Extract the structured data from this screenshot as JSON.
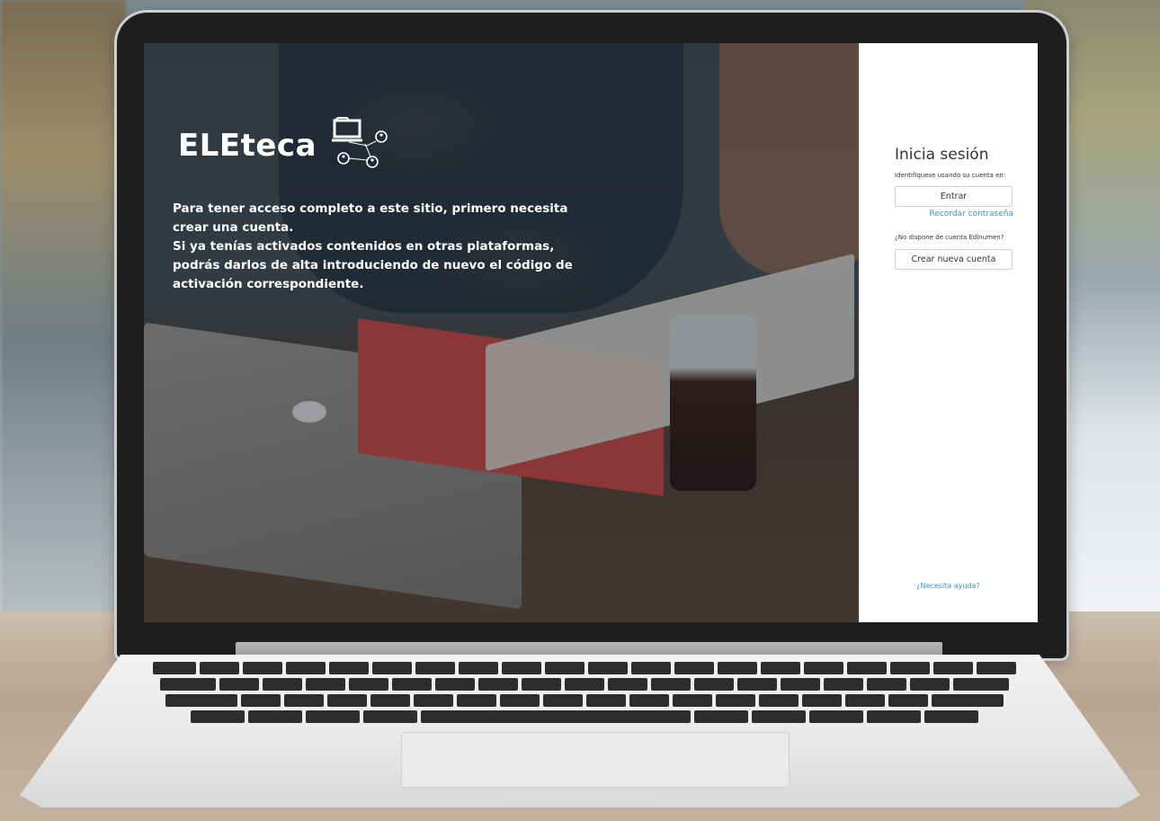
{
  "brand": {
    "name": "ELEteca",
    "icon": "laptop-network-icon"
  },
  "hero": {
    "line1": "Para tener acceso completo a este sitio, primero necesita crear una cuenta.",
    "line2": "Si ya tenías activados contenidos en otras plataformas, podrás darlos de alta introduciendo de nuevo el código de activación correspondiente."
  },
  "login": {
    "title": "Inicia sesión",
    "subtitle": "Identifíquese usando su cuenta en:",
    "enter_label": "Entrar",
    "remember_label": "Recordar contraseña",
    "no_account": "¿No dispone de cuenta Edinumen?",
    "create_label": "Crear nueva cuenta",
    "help_label": "¿Necesita ayuda?"
  },
  "colors": {
    "link": "#3a8ed6",
    "panel_bg": "#ffffff",
    "text": "#333333"
  }
}
